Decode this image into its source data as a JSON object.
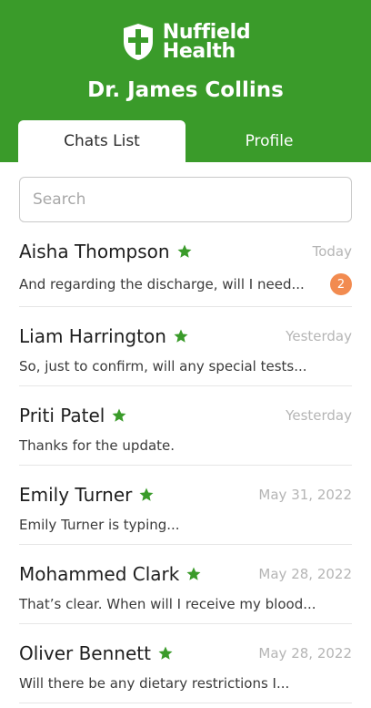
{
  "brand": {
    "line1": "Nuffield",
    "line2": "Health"
  },
  "doctor_name": "Dr. James Collins",
  "tabs": [
    {
      "label": "Chats List",
      "active": true
    },
    {
      "label": "Profile",
      "active": false
    }
  ],
  "search": {
    "placeholder": "Search",
    "value": ""
  },
  "chats": [
    {
      "name": "Aisha Thompson",
      "date": "Today",
      "message": "And regarding the discharge, will I need...",
      "unread": "2"
    },
    {
      "name": "Liam Harrington",
      "date": "Yesterday",
      "message": "So, just to confirm, will any special tests..."
    },
    {
      "name": "Priti Patel",
      "date": "Yesterday",
      "message": "Thanks for the update."
    },
    {
      "name": "Emily Turner",
      "date": "May 31, 2022",
      "message": "Emily Turner is typing..."
    },
    {
      "name": "Mohammed Clark",
      "date": "May 28, 2022",
      "message": "That’s clear. When will I receive my blood..."
    },
    {
      "name": "Oliver Bennett",
      "date": "May 28, 2022",
      "message": "Will there be any dietary restrictions I..."
    }
  ],
  "colors": {
    "brand_green": "#3a9b2a",
    "star_green": "#3a9b2a",
    "badge_orange": "#f28b50"
  },
  "icons": {
    "logo": "nuffield-shield-icon",
    "favorite": "star-icon"
  }
}
